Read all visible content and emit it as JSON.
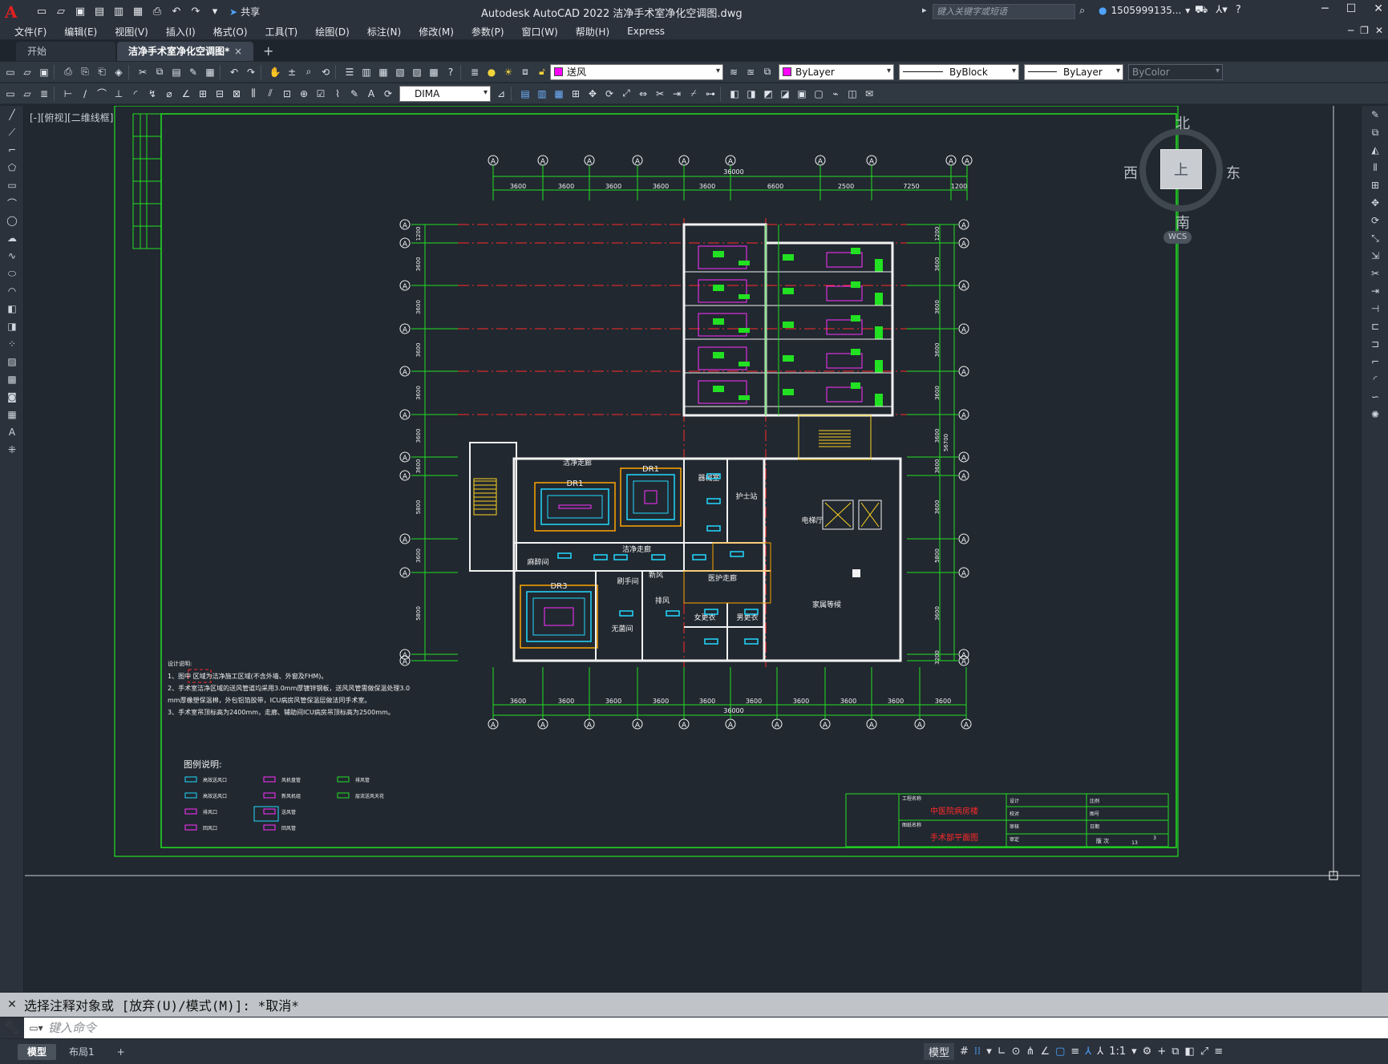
{
  "titlebar": {
    "app_icon": "autocad-logo-icon",
    "share_label": "共享",
    "title": "Autodesk AutoCAD 2022    洁净手术室净化空调图.dwg",
    "search_placeholder": "键入关键字或短语",
    "user": "1505999135...",
    "help_label": "?"
  },
  "menubar": {
    "items": [
      "文件(F)",
      "编辑(E)",
      "视图(V)",
      "插入(I)",
      "格式(O)",
      "工具(T)",
      "绘图(D)",
      "标注(N)",
      "修改(M)",
      "参数(P)",
      "窗口(W)",
      "帮助(H)",
      "Express"
    ]
  },
  "tabs": {
    "start": "开始",
    "active": "洁净手术室净化空调图*",
    "close": "×",
    "add": "+"
  },
  "toolbar1": {
    "layer_name": "送风",
    "color": "ByLayer",
    "linetype": "ByBlock",
    "lineweight": "ByLayer",
    "plotstyle": "ByColor"
  },
  "toolbar2": {
    "dimstyle": "DIMA"
  },
  "viewport": {
    "label": "[-][俯视][二维线框]",
    "viewcube": {
      "top": "上",
      "north": "北",
      "south": "南",
      "east": "东",
      "west": "西",
      "wcs": "WCS"
    }
  },
  "drawing": {
    "grid_bubble": "A",
    "top_dims": [
      "3600",
      "3600",
      "3600",
      "3600",
      "3600",
      "6600",
      "2500",
      "7250",
      "1200"
    ],
    "top_total": "36000",
    "bottom_dims": [
      "3600",
      "3600",
      "3600",
      "3600",
      "3600",
      "3600",
      "3600",
      "3600",
      "3600",
      "3600"
    ],
    "bottom_total": "36000",
    "left_dims": [
      "1200",
      "3600",
      "3600",
      "3600",
      "3600",
      "3600",
      "3600",
      "5800",
      "3600",
      "5800"
    ],
    "right_dims": [
      "1200",
      "3600",
      "3600",
      "3600",
      "3600",
      "3600",
      "3600",
      "3600",
      "5800",
      "3600",
      "3200",
      "5800"
    ],
    "right_total": "56700",
    "rooms": {
      "op_room_1": "DR1",
      "op_room_2": "DR1",
      "op_room_3": "DR3",
      "corridor_1": "洁净走廊",
      "corridor_2": "洁净走廊",
      "corridor_3": "医护走廊",
      "nurse_station": "护士站",
      "instrument": "器械室",
      "elevator": "电梯厅",
      "waiting": "家属等候",
      "male_change": "男更衣",
      "female_change": "女更衣",
      "anesthesia": "麻醉间",
      "hand_wash": "刷手间",
      "sterile": "无菌间",
      "fresh": "新风",
      "exhaust": "排风"
    },
    "notes": {
      "title": "设计说明:",
      "lines": [
        "1、图中         区域为洁净施工区域(不含外墙、外窗及FHM)。",
        "2、手术室洁净区域的送风管道均采用3.0mm厚镀锌钢板，送风风管需做保温处理3.0",
        "   mm厚橡塑保温棉，外包铝箔胶带，ICU病房风管保温层做法同手术室。",
        "3、手术室吊顶标高为2400mm，走廊、辅助间ICU病房吊顶标高为2500mm。"
      ]
    },
    "legend": {
      "title": "图例说明:",
      "items": [
        "高效送风口",
        "高效送风口",
        "排风口",
        "回风口",
        "风机盘管",
        "新风机组",
        "送风管",
        "回风管",
        "排风管",
        "层流送风天花"
      ]
    },
    "title_block": {
      "project_label": "工程名称",
      "project_name": "中医院病房楼",
      "drawing_label": "图纸名称",
      "drawing_name": "手术部平面图",
      "fields": [
        "设计",
        "校对",
        "审核",
        "审定",
        "比例",
        "图号",
        "日期"
      ],
      "sheet": "版 次",
      "sheet_no": "3",
      "total": "13"
    }
  },
  "command": {
    "history": "选择注释对象或 [放弃(U)/模式(M)]: *取消*",
    "placeholder": "键入命令"
  },
  "statusbar": {
    "model_tab": "模型",
    "layout_tab": "布局1",
    "add": "+",
    "model_label": "模型",
    "scale": "1:1"
  }
}
